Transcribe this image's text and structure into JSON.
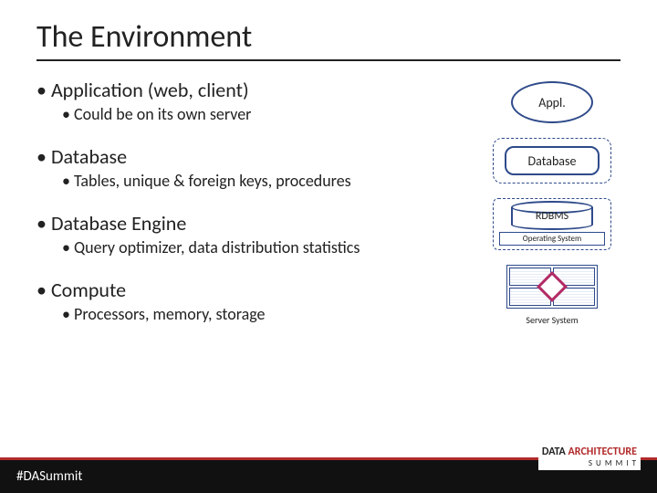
{
  "title": "The Environment",
  "bullets": {
    "app": "Application (web, client)",
    "app_sub": "Could be on its own server",
    "db": "Database",
    "db_sub": "Tables, unique & foreign keys, procedures",
    "engine": "Database Engine",
    "engine_sub": "Query optimizer, data distribution statistics",
    "compute": "Compute",
    "compute_sub": "Processors, memory, storage"
  },
  "diagrams": {
    "appl": "Appl.",
    "database": "Database",
    "rdbms": "RDBMS",
    "os": "Operating System",
    "server": "Server System"
  },
  "footer": {
    "hashtag": "#DASummit",
    "logo_data": "DATA",
    "logo_arch": "ARCHITECTURE",
    "logo_summit": "S U M M I T"
  }
}
